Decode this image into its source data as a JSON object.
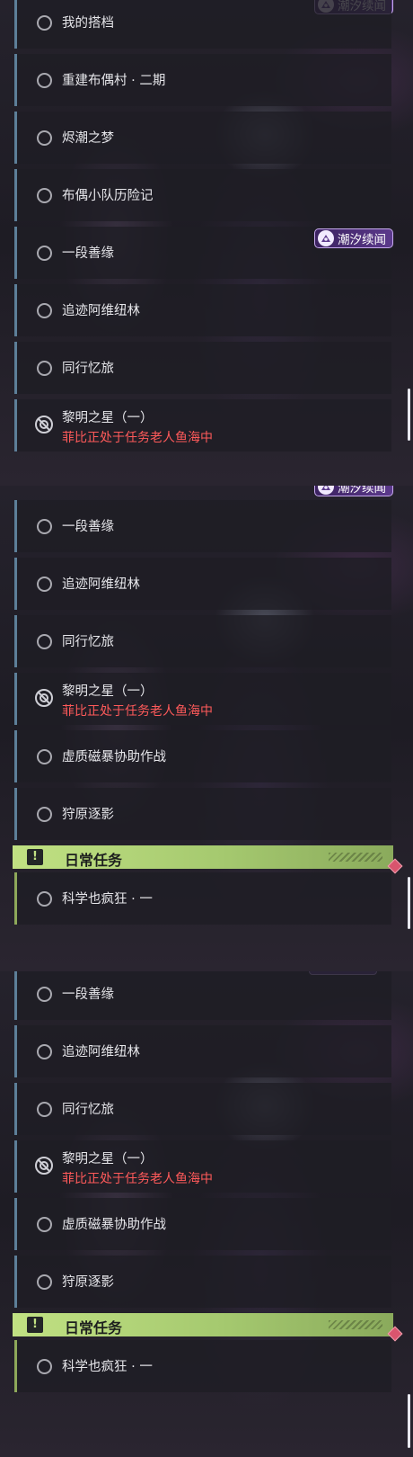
{
  "badge_label": "潮汐续闻",
  "daily_category": "日常任务",
  "colors": {
    "accent_purple": "#5c3a8c",
    "daily_green": "#a5c96f",
    "tracked_red": "#ff5a5a"
  },
  "panels": [
    {
      "items": [
        {
          "label": "我的搭档"
        },
        {
          "label": "重建布偶村 · 二期"
        },
        {
          "label": "烬潮之梦"
        },
        {
          "label": "布偶小队历险记"
        },
        {
          "label": "一段善缘"
        },
        {
          "label": "追迹阿维纽林"
        },
        {
          "label": "同行忆旅"
        },
        {
          "label": "黎明之星（一）",
          "sub": "菲比正处于任务老人鱼海中"
        }
      ]
    },
    {
      "items": [
        {
          "label": "一段善缘"
        },
        {
          "label": "追迹阿维纽林"
        },
        {
          "label": "同行忆旅"
        },
        {
          "label": "黎明之星（一）",
          "sub": "菲比正处于任务老人鱼海中"
        },
        {
          "label": "虚质磁暴协助作战"
        },
        {
          "label": "狩原逐影"
        }
      ],
      "daily_items": [
        {
          "label": "科学也疯狂 · 一"
        }
      ]
    },
    {
      "items": [
        {
          "label": "一段善缘"
        },
        {
          "label": "追迹阿维纽林"
        },
        {
          "label": "同行忆旅"
        },
        {
          "label": "黎明之星（一）",
          "sub": "菲比正处于任务老人鱼海中"
        },
        {
          "label": "虚质磁暴协助作战"
        },
        {
          "label": "狩原逐影"
        }
      ],
      "daily_items": [
        {
          "label": "科学也疯狂 · 一"
        }
      ]
    }
  ]
}
